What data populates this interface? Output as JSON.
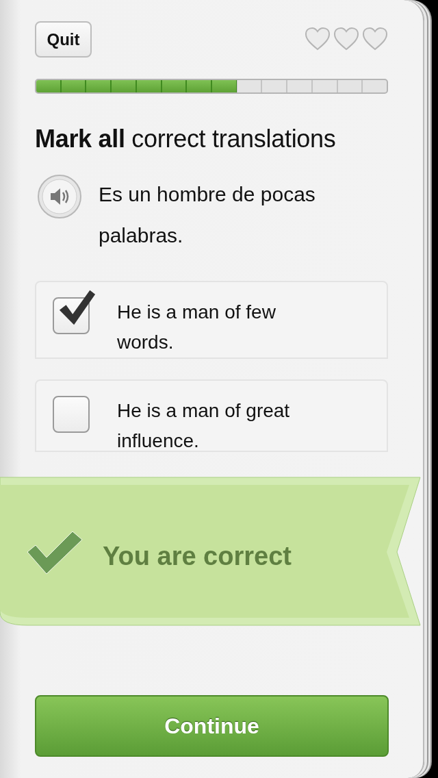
{
  "header": {
    "quit_button": "Quit",
    "hearts": [
      {
        "filled": false
      },
      {
        "filled": false
      },
      {
        "filled": false
      }
    ]
  },
  "progress": {
    "level": 0.5714
  },
  "instruction": "**Mark all** correct translations",
  "prompt": {
    "text": "Es un hombre de pocas palabras."
  },
  "options": [
    {
      "text": "He is a man of few words.",
      "checked": true
    },
    {
      "text": "He is a man of great influence.",
      "checked": false
    }
  ],
  "feedback": {
    "text": "You are correct"
  },
  "continue_button": "Continue"
}
